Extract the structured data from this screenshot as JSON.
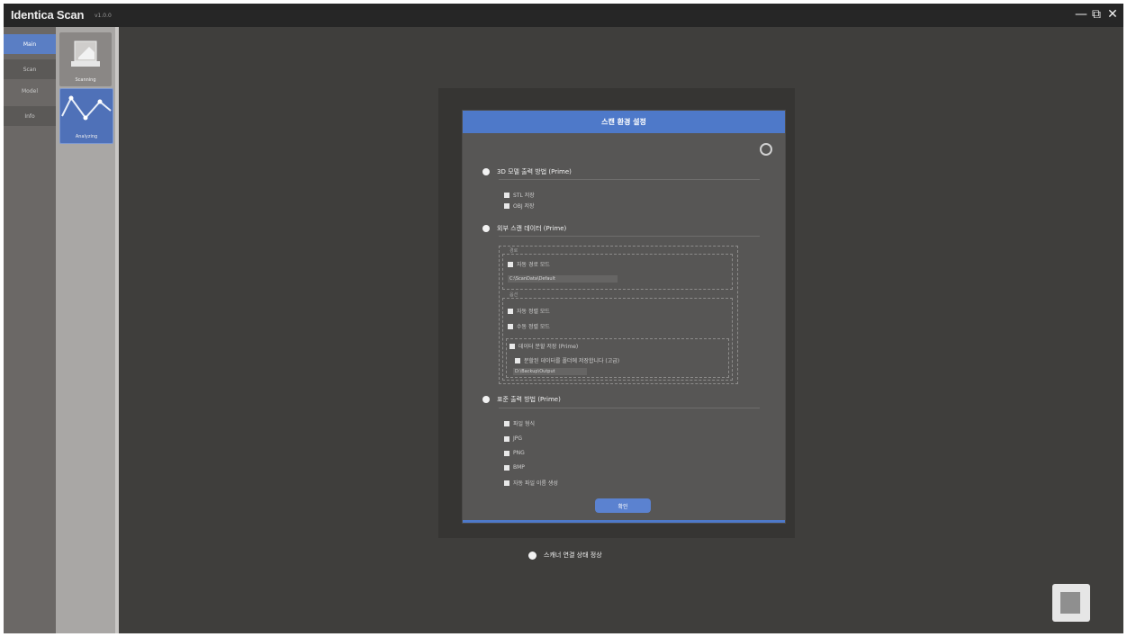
{
  "window": {
    "title": "Identica Scan",
    "version": "v1.0.0",
    "controls": {
      "minimize": "—",
      "restore": "⧉",
      "close": "✕"
    }
  },
  "leftnav": {
    "items": [
      {
        "label": "Main"
      },
      {
        "label": "Scan"
      },
      {
        "label": "Model"
      },
      {
        "label": "Info"
      }
    ]
  },
  "toolstrip": {
    "cards": [
      {
        "label": "Scanning",
        "icon": "scanner-icon"
      },
      {
        "label": "Analyzing",
        "icon": "curve-graph-icon"
      }
    ]
  },
  "dialog": {
    "title": "스캔 환경 설정",
    "sections": [
      {
        "title": "3D 모델 출력 방법 (Prime)",
        "options": [
          {
            "label": "STL 저장",
            "checked": true
          },
          {
            "label": "OBJ 저장",
            "checked": true
          }
        ]
      },
      {
        "title": "외부 스캔 데이터 (Prime)",
        "groups": [
          {
            "label": "경로",
            "options": [
              {
                "label": "자동 경로 모드",
                "checked": true
              }
            ],
            "field": "C:\\ScanData\\Default"
          },
          {
            "label": "옵션",
            "options": [
              {
                "label": "자동 정렬 모드",
                "checked": true
              },
              {
                "label": "수동 정렬 모드",
                "checked": true
              },
              {
                "label": "데이터 분할 저장 (Prime)",
                "checked": true
              }
            ],
            "sub_option": "분할된 데이터를 폴더에 저장합니다 (고급)",
            "field": "D:\\Backup\\Output"
          }
        ]
      },
      {
        "title": "표준 출력 방법 (Prime)",
        "options": [
          {
            "label": "파일 형식",
            "checked": true
          },
          {
            "label": "JPG",
            "checked": true
          },
          {
            "label": "PNG",
            "checked": true
          },
          {
            "label": "BMP",
            "checked": true
          },
          {
            "label": "자동 파일 이름 생성",
            "checked": true
          }
        ]
      }
    ],
    "ok_label": "확인"
  },
  "status": {
    "label": "스캐너 연결 상태 정상"
  },
  "colors": {
    "accent": "#4e79c9",
    "background": "#3f3e3c",
    "titlebar": "#262626"
  }
}
